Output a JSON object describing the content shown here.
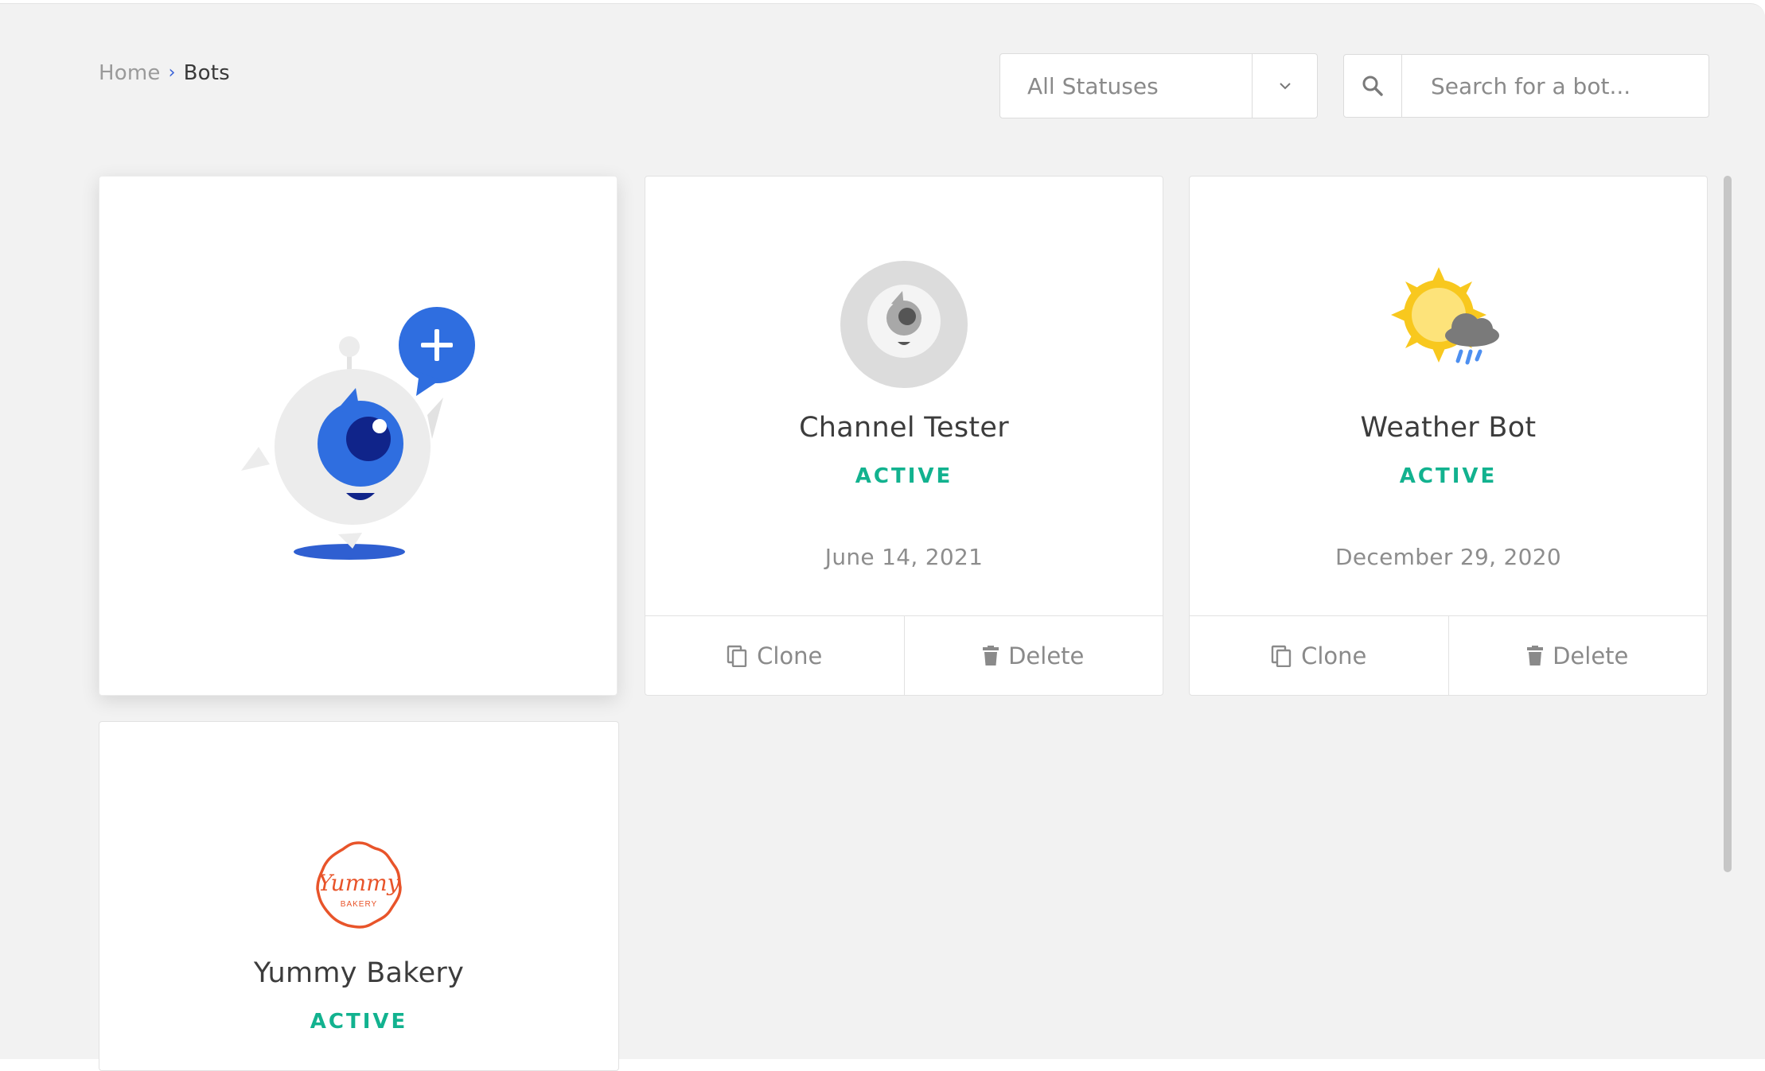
{
  "breadcrumb": {
    "home": "Home",
    "separator": "›",
    "current": "Bots"
  },
  "filters": {
    "status_selected": "All Statuses",
    "search_placeholder": "Search for a bot..."
  },
  "bots": [
    {
      "name": "Channel Tester",
      "status": "ACTIVE",
      "date": "June 14, 2021",
      "avatar_icon": "eye-bot-icon",
      "actions": {
        "clone": "Clone",
        "delete": "Delete"
      }
    },
    {
      "name": "Weather Bot",
      "status": "ACTIVE",
      "date": "December 29, 2020",
      "avatar_icon": "weather-sun-cloud-icon",
      "actions": {
        "clone": "Clone",
        "delete": "Delete"
      }
    },
    {
      "name": "Yummy Bakery",
      "status": "ACTIVE",
      "avatar_icon": "bakery-logo-icon",
      "logo_text": "Yummy",
      "logo_subtext": "BAKERY"
    }
  ],
  "colors": {
    "accent_blue": "#2f6ee0",
    "status_active": "#12b28f",
    "background": "#f2f2f2",
    "bakery_orange": "#e8542a",
    "sun_yellow": "#f8c81e"
  }
}
